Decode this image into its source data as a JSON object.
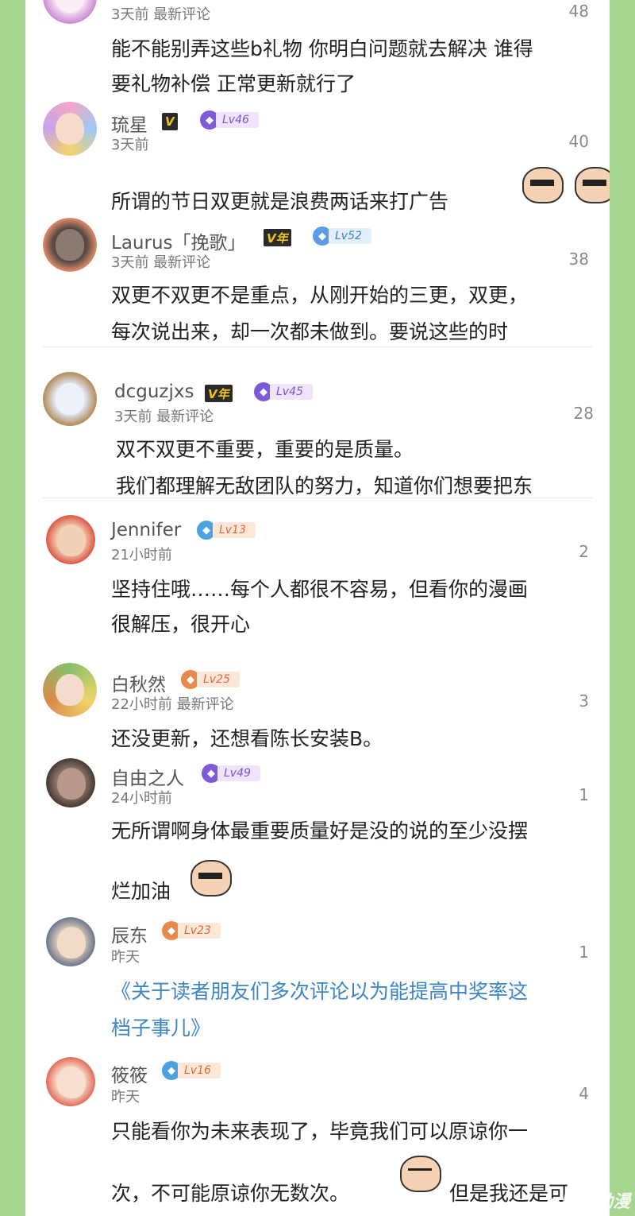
{
  "colors": {
    "frame": "#a8d492",
    "link": "#3d86c6",
    "vip_bg": "#2a2a2a",
    "vip_fg": "#f3c21a"
  },
  "comments": [
    {
      "name": "",
      "meta": "3天前  最新评论",
      "count": "48",
      "lines": [
        "能不能别弄这些b礼物 你明白问题就去解决 谁得",
        "要礼物补偿 正常更新就行了"
      ]
    },
    {
      "name": "琉星",
      "vip": "V",
      "level": "Lv46",
      "meta": "3天前",
      "count": "40",
      "lines": [
        "所谓的节日双更就是浪费两话来打广告"
      ]
    },
    {
      "name": "Laurus「挽歌」",
      "vip": "V年",
      "level": "Lv52",
      "meta": "3天前  最新评论",
      "count": "38",
      "lines": [
        "双更不双更不是重点，从刚开始的三更，双更，",
        "每次说出来，却一次都未做到。要说这些的时"
      ]
    },
    {
      "name": "dcguzjxs",
      "vip": "V年",
      "level": "Lv45",
      "meta": "3天前  最新评论",
      "count": "28",
      "lines": [
        "双不双更不重要，重要的是质量。",
        "我们都理解无敌团队的努力，知道你们想要把东"
      ]
    },
    {
      "name": "Jennifer",
      "level": "Lv13",
      "meta": "21小时前",
      "count": "2",
      "lines": [
        "坚持住哦……每个人都很不容易，但看你的漫画",
        "很解压，很开心"
      ]
    },
    {
      "name": "白秋然",
      "level": "Lv25",
      "meta": "22小时前  最新评论",
      "count": "3",
      "lines": [
        "还没更新，还想看陈长安装B。"
      ]
    },
    {
      "name": "自由之人",
      "level": "Lv49",
      "meta": "24小时前",
      "count": "1",
      "lines": [
        "无所谓啊身体最重要质量好是没的说的至少没摆",
        "烂加油"
      ]
    },
    {
      "name": "辰东",
      "level": "Lv23",
      "meta": "昨天",
      "count": "1",
      "lines": [
        "《关于读者朋友们多次评论以为能提高中奖率这",
        "档子事儿》"
      ]
    },
    {
      "name": "筱筱",
      "level": "Lv16",
      "meta": "昨天",
      "count": "4",
      "lines": [
        "只能看你为未来表现了，毕竟我们可以原谅你一",
        "次，不可能原谅你无数次。",
        "但是我还是可"
      ]
    }
  ],
  "watermark": "腾讯动漫",
  "icons": [
    "avatar",
    "level-badge-icon",
    "vip-badge",
    "emoji-sticker"
  ]
}
